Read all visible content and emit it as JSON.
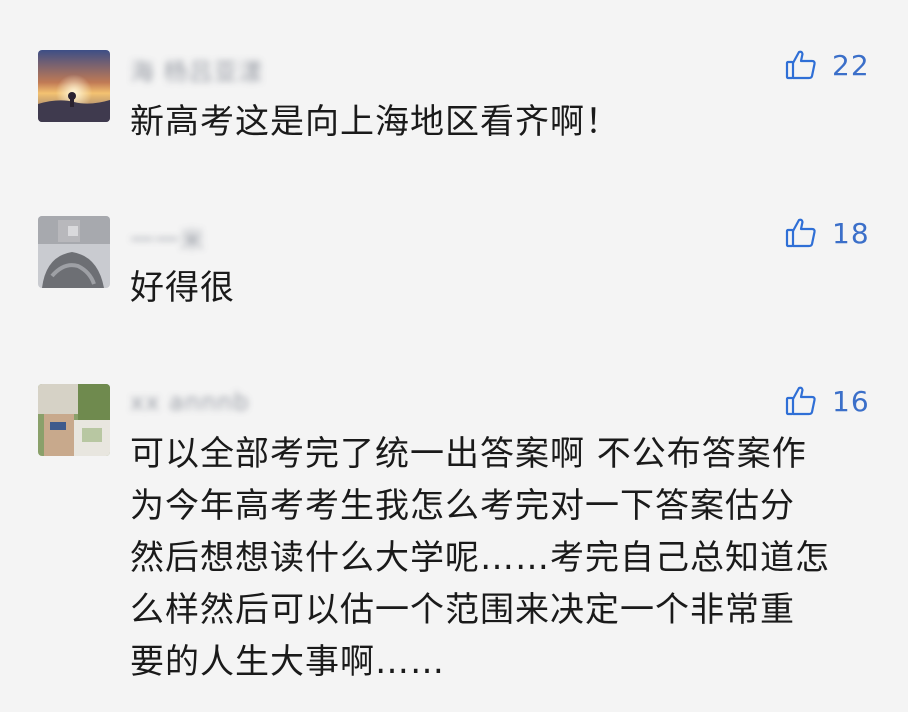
{
  "comments": [
    {
      "username": "海 杨吕亚漾",
      "likes": "22",
      "text_lines": [
        "新高考这是向上海地区看齐啊！"
      ]
    },
    {
      "username": "一一米",
      "likes": "18",
      "text_lines": [
        "好得很"
      ]
    },
    {
      "username": "xx annnb",
      "likes": "16",
      "text_lines": [
        "可以全部考完了统一出答案啊 不公布答案作",
        "为今年高考考生我怎么考完对一下答案估分",
        "然后想想读什么大学呢……考完自己总知道怎",
        "么样然后可以估一个范围来决定一个非常重",
        "要的人生大事啊……"
      ]
    }
  ],
  "colors": {
    "background": "#f4f4f4",
    "like_blue": "#2f6fd6",
    "text": "#1a1a1a",
    "username_gray": "#8a8f99"
  },
  "icons": {
    "like": "thumbs-up-icon"
  }
}
